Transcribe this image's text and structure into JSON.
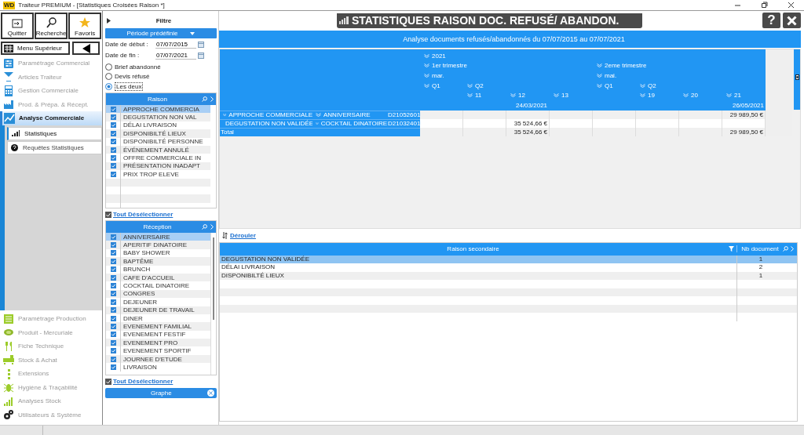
{
  "window": {
    "app_badge": "WD",
    "title": "Traiteur PREMIUM - [Statistiques Croisées Raison *]"
  },
  "toolbar": {
    "buttons": [
      "Quitter",
      "Recherche",
      "Favoris"
    ],
    "menu_button": "Menu Supérieur"
  },
  "nav_top": [
    {
      "label": "Paramétrage Commercial",
      "selected": false
    },
    {
      "label": "Articles Traiteur",
      "selected": false
    },
    {
      "label": "Gestion Commerciale",
      "selected": false
    },
    {
      "label": "Prod. & Prépa. &  Récept.",
      "selected": false
    },
    {
      "label": "Analyse Commerciale",
      "selected": true
    }
  ],
  "nav_sub": [
    {
      "label": "Statistiques",
      "selected": true
    },
    {
      "label": "Requêtes Statistiques",
      "selected": false
    }
  ],
  "nav_bottom": [
    {
      "label": "Paramétrage Production"
    },
    {
      "label": "Produit - Mercuriale"
    },
    {
      "label": "Fiche Technique"
    },
    {
      "label": "Stock & Achat"
    },
    {
      "label": "Extensions"
    },
    {
      "label": "Hygiène & Traçabilité"
    },
    {
      "label": "Analyses Stock"
    },
    {
      "label": "Utilisateurs & Système"
    }
  ],
  "filter": {
    "title": "Filtre",
    "period_button": "Période prédéfinie",
    "start_label": "Date de début :",
    "start_value": "07/07/2015",
    "end_label": "Date de fin :",
    "end_value": "07/07/2021",
    "radios": [
      {
        "label": "Brief abandonné",
        "selected": false
      },
      {
        "label": "Devis réfusé",
        "selected": false
      },
      {
        "label": "Les deux",
        "selected": true
      }
    ],
    "lists": [
      {
        "title": "Raison",
        "deselect_label": "Tout Désélectionner",
        "deselect_checked": true,
        "items": [
          {
            "label": "APPROCHE COMMERCIA",
            "checked": true,
            "selected": true
          },
          {
            "label": "DEGUSTATION NON VAL",
            "checked": true,
            "selected": false
          },
          {
            "label": "DÉLAI LIVRAISON",
            "checked": true,
            "selected": false
          },
          {
            "label": "DISPONIBILTÉ LIEUX",
            "checked": true,
            "selected": false
          },
          {
            "label": "DISPONIBILTÉ PERSONNE",
            "checked": true,
            "selected": false
          },
          {
            "label": "ÉVÉNEMENT ANNULÉ",
            "checked": true,
            "selected": false
          },
          {
            "label": "OFFRE COMMERCIALE IN",
            "checked": true,
            "selected": false
          },
          {
            "label": "PRÉSENTATION INADAPT",
            "checked": true,
            "selected": false
          },
          {
            "label": "PRIX TROP ELEVE",
            "checked": true,
            "selected": false
          }
        ]
      },
      {
        "title": "Réception",
        "deselect_label": "Tout Désélectionner",
        "deselect_checked": true,
        "items": [
          {
            "label": "ANNIVERSAIRE",
            "checked": true,
            "selected": true
          },
          {
            "label": "APERITIF DINATOIRE",
            "checked": true,
            "selected": false
          },
          {
            "label": "BABY SHOWER",
            "checked": true,
            "selected": false
          },
          {
            "label": "BAPTÊME",
            "checked": true,
            "selected": false
          },
          {
            "label": "BRUNCH",
            "checked": true,
            "selected": false
          },
          {
            "label": "CAFE D'ACCUEIL",
            "checked": true,
            "selected": false
          },
          {
            "label": "COCKTAIL DINATOIRE",
            "checked": true,
            "selected": false
          },
          {
            "label": "CONGRES",
            "checked": true,
            "selected": false
          },
          {
            "label": "DEJEUNER",
            "checked": true,
            "selected": false
          },
          {
            "label": "DEJEUNER DE TRAVAIL",
            "checked": true,
            "selected": false
          },
          {
            "label": "DINER",
            "checked": true,
            "selected": false
          },
          {
            "label": "EVENEMENT FAMILIAL",
            "checked": true,
            "selected": false
          },
          {
            "label": "EVENEMENT FESTIF",
            "checked": true,
            "selected": false
          },
          {
            "label": "EVENEMENT PRO",
            "checked": true,
            "selected": false
          },
          {
            "label": "EVENEMENT SPORTIF",
            "checked": true,
            "selected": false
          },
          {
            "label": "JOURNEE D'ETUDE",
            "checked": true,
            "selected": false
          },
          {
            "label": "LIVRAISON",
            "checked": true,
            "selected": false
          }
        ]
      }
    ],
    "graph_button": "Graphe"
  },
  "banner": {
    "title": "STATISTIQUES RAISON DOC. REFUSÉ/ ABANDON.",
    "help_button": "?"
  },
  "pivot": {
    "title": "Analyse documents refusés/abandonnés du 07/07/2015 au 07/07/2021",
    "columns": [
      {
        "year": "2021",
        "trimester": "1er trimestre",
        "month": "mar.",
        "q": "Q1"
      },
      {
        "q": "Q2",
        "week": "11"
      },
      {
        "week": "12",
        "date": "24/03/2021"
      },
      {
        "week": "13"
      },
      {
        "trimester": "2eme trimestre",
        "month": "mai.",
        "q": "Q1"
      },
      {
        "q": "Q2",
        "week": "19"
      },
      {
        "week": "20"
      },
      {
        "week": "21",
        "date": "26/05/2021"
      }
    ],
    "rows": [
      {
        "raison": "APPROCHE COMMERCIALE",
        "reception": "ANNIVERSAIRE",
        "document": "D21052601",
        "cells": [
          "",
          "",
          "",
          "",
          "",
          "",
          "",
          "29 989,50 €"
        ]
      },
      {
        "raison": "DEGUSTATION NON VALIDÉE",
        "reception": "COCKTAIL DINATOIRE",
        "document": "D21032401",
        "cells": [
          "",
          "",
          "35 524,66 €",
          "",
          "",
          "",
          "",
          ""
        ]
      }
    ],
    "total": {
      "label": "Total",
      "cells": [
        "",
        "",
        "35 524,66 €",
        "",
        "",
        "",
        "",
        "29 989,50 €"
      ]
    }
  },
  "expand_link": "Dérouler",
  "secondary": {
    "columns": [
      "Raison secondaire",
      "Nb document"
    ],
    "rows": [
      {
        "reason": "DEGUSTATION NON VALIDÉE",
        "count": "1",
        "selected": true
      },
      {
        "reason": "DÉLAI LIVRAISON",
        "count": "2",
        "selected": false
      },
      {
        "reason": "DISPONIBILTÉ LIEUX",
        "count": "1",
        "selected": false
      }
    ]
  }
}
